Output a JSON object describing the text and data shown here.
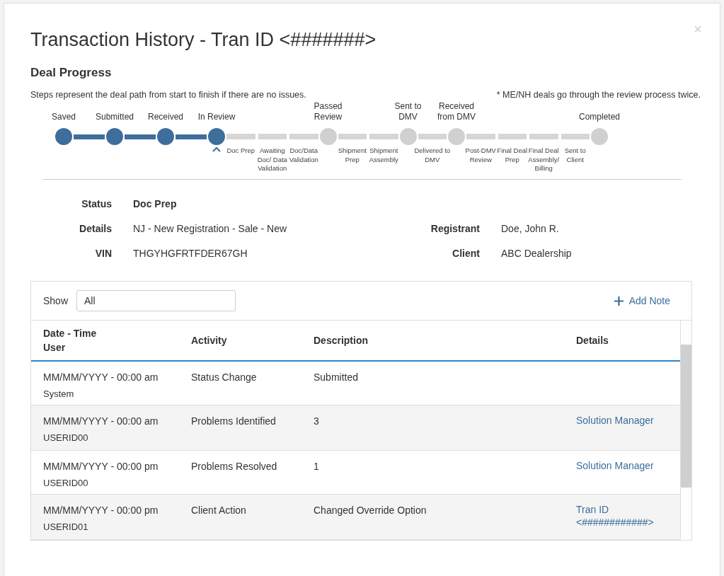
{
  "dialog": {
    "title": "Transaction History - Tran ID <#######>",
    "close": "×"
  },
  "progress": {
    "heading": "Deal Progress",
    "description": "Steps represent the deal path from start to finish if there are no issues.",
    "note": "* ME/NH deals go through the review process twice.",
    "steps": [
      {
        "kind": "milestone",
        "label": "Saved",
        "done": true,
        "current": false
      },
      {
        "kind": "substep",
        "done": true
      },
      {
        "kind": "milestone",
        "label": "Submitted",
        "done": true,
        "current": false
      },
      {
        "kind": "substep",
        "done": true
      },
      {
        "kind": "milestone",
        "label": "Received",
        "done": true,
        "current": false
      },
      {
        "kind": "substep",
        "done": true
      },
      {
        "kind": "milestone",
        "label": "In Review",
        "done": true,
        "current": true
      },
      {
        "kind": "substep",
        "label": "Doc Prep",
        "done": false
      },
      {
        "kind": "substep",
        "label": "Awaiting Doc/ Data Validation",
        "done": false
      },
      {
        "kind": "substep",
        "label": "Doc/Data Validation",
        "done": false
      },
      {
        "kind": "milestone",
        "label": "Passed Review",
        "done": false,
        "current": false
      },
      {
        "kind": "substep",
        "label": "Shipment Prep",
        "done": false
      },
      {
        "kind": "substep",
        "label": "Shipment Assembly",
        "done": false
      },
      {
        "kind": "milestone",
        "label": "Sent to DMV",
        "done": false,
        "current": false
      },
      {
        "kind": "substep",
        "label": "Delivered to DMV",
        "done": false
      },
      {
        "kind": "milestone",
        "label": "Received from DMV",
        "done": false,
        "current": false
      },
      {
        "kind": "substep",
        "label": "Post-DMV Review",
        "done": false
      },
      {
        "kind": "substep",
        "label": "Final Deal Prep",
        "done": false
      },
      {
        "kind": "substep",
        "label": "Final Deal Assembly/ Billing",
        "done": false
      },
      {
        "kind": "substep",
        "label": "Sent to Client",
        "done": false
      },
      {
        "kind": "milestone",
        "label": "Completed",
        "done": false,
        "current": false
      }
    ]
  },
  "summary": {
    "status": {
      "label": "Status",
      "value": "Doc Prep"
    },
    "left": [
      {
        "label": "Details",
        "value": "NJ - New Registration - Sale - New"
      },
      {
        "label": "VIN",
        "value": "THGYHGFRTFDER67GH"
      }
    ],
    "right": [
      {
        "label": "Registrant",
        "value": "Doe, John R."
      },
      {
        "label": "Client",
        "value": "ABC Dealership"
      }
    ]
  },
  "history": {
    "show_label": "Show",
    "show_value": "All",
    "add_note": "Add Note",
    "columns": [
      {
        "label": "Date - Time",
        "sublabel": "User"
      },
      {
        "label": "Activity"
      },
      {
        "label": "Description"
      },
      {
        "label": "Details"
      }
    ],
    "rows": [
      {
        "datetime": "MM/MM/YYYY - 00:00 am",
        "user": "System",
        "activity": "Status Change",
        "description": "Submitted"
      },
      {
        "datetime": "MM/MM/YYYY - 00:00 am",
        "user": "USERID00",
        "activity": "Problems Identified",
        "description": "3",
        "details": "Solution Manager"
      },
      {
        "datetime": "MM/MM/YYYY - 00:00 pm",
        "user": "USERID00",
        "activity": "Problems Resolved",
        "description": "1",
        "details": "Solution Manager"
      },
      {
        "datetime": "MM/MM/YYYY - 00:00 pm",
        "user": "USERID01",
        "activity": "Client Action",
        "description": "Changed Override Option",
        "details": "Tran ID <############>"
      }
    ]
  }
}
